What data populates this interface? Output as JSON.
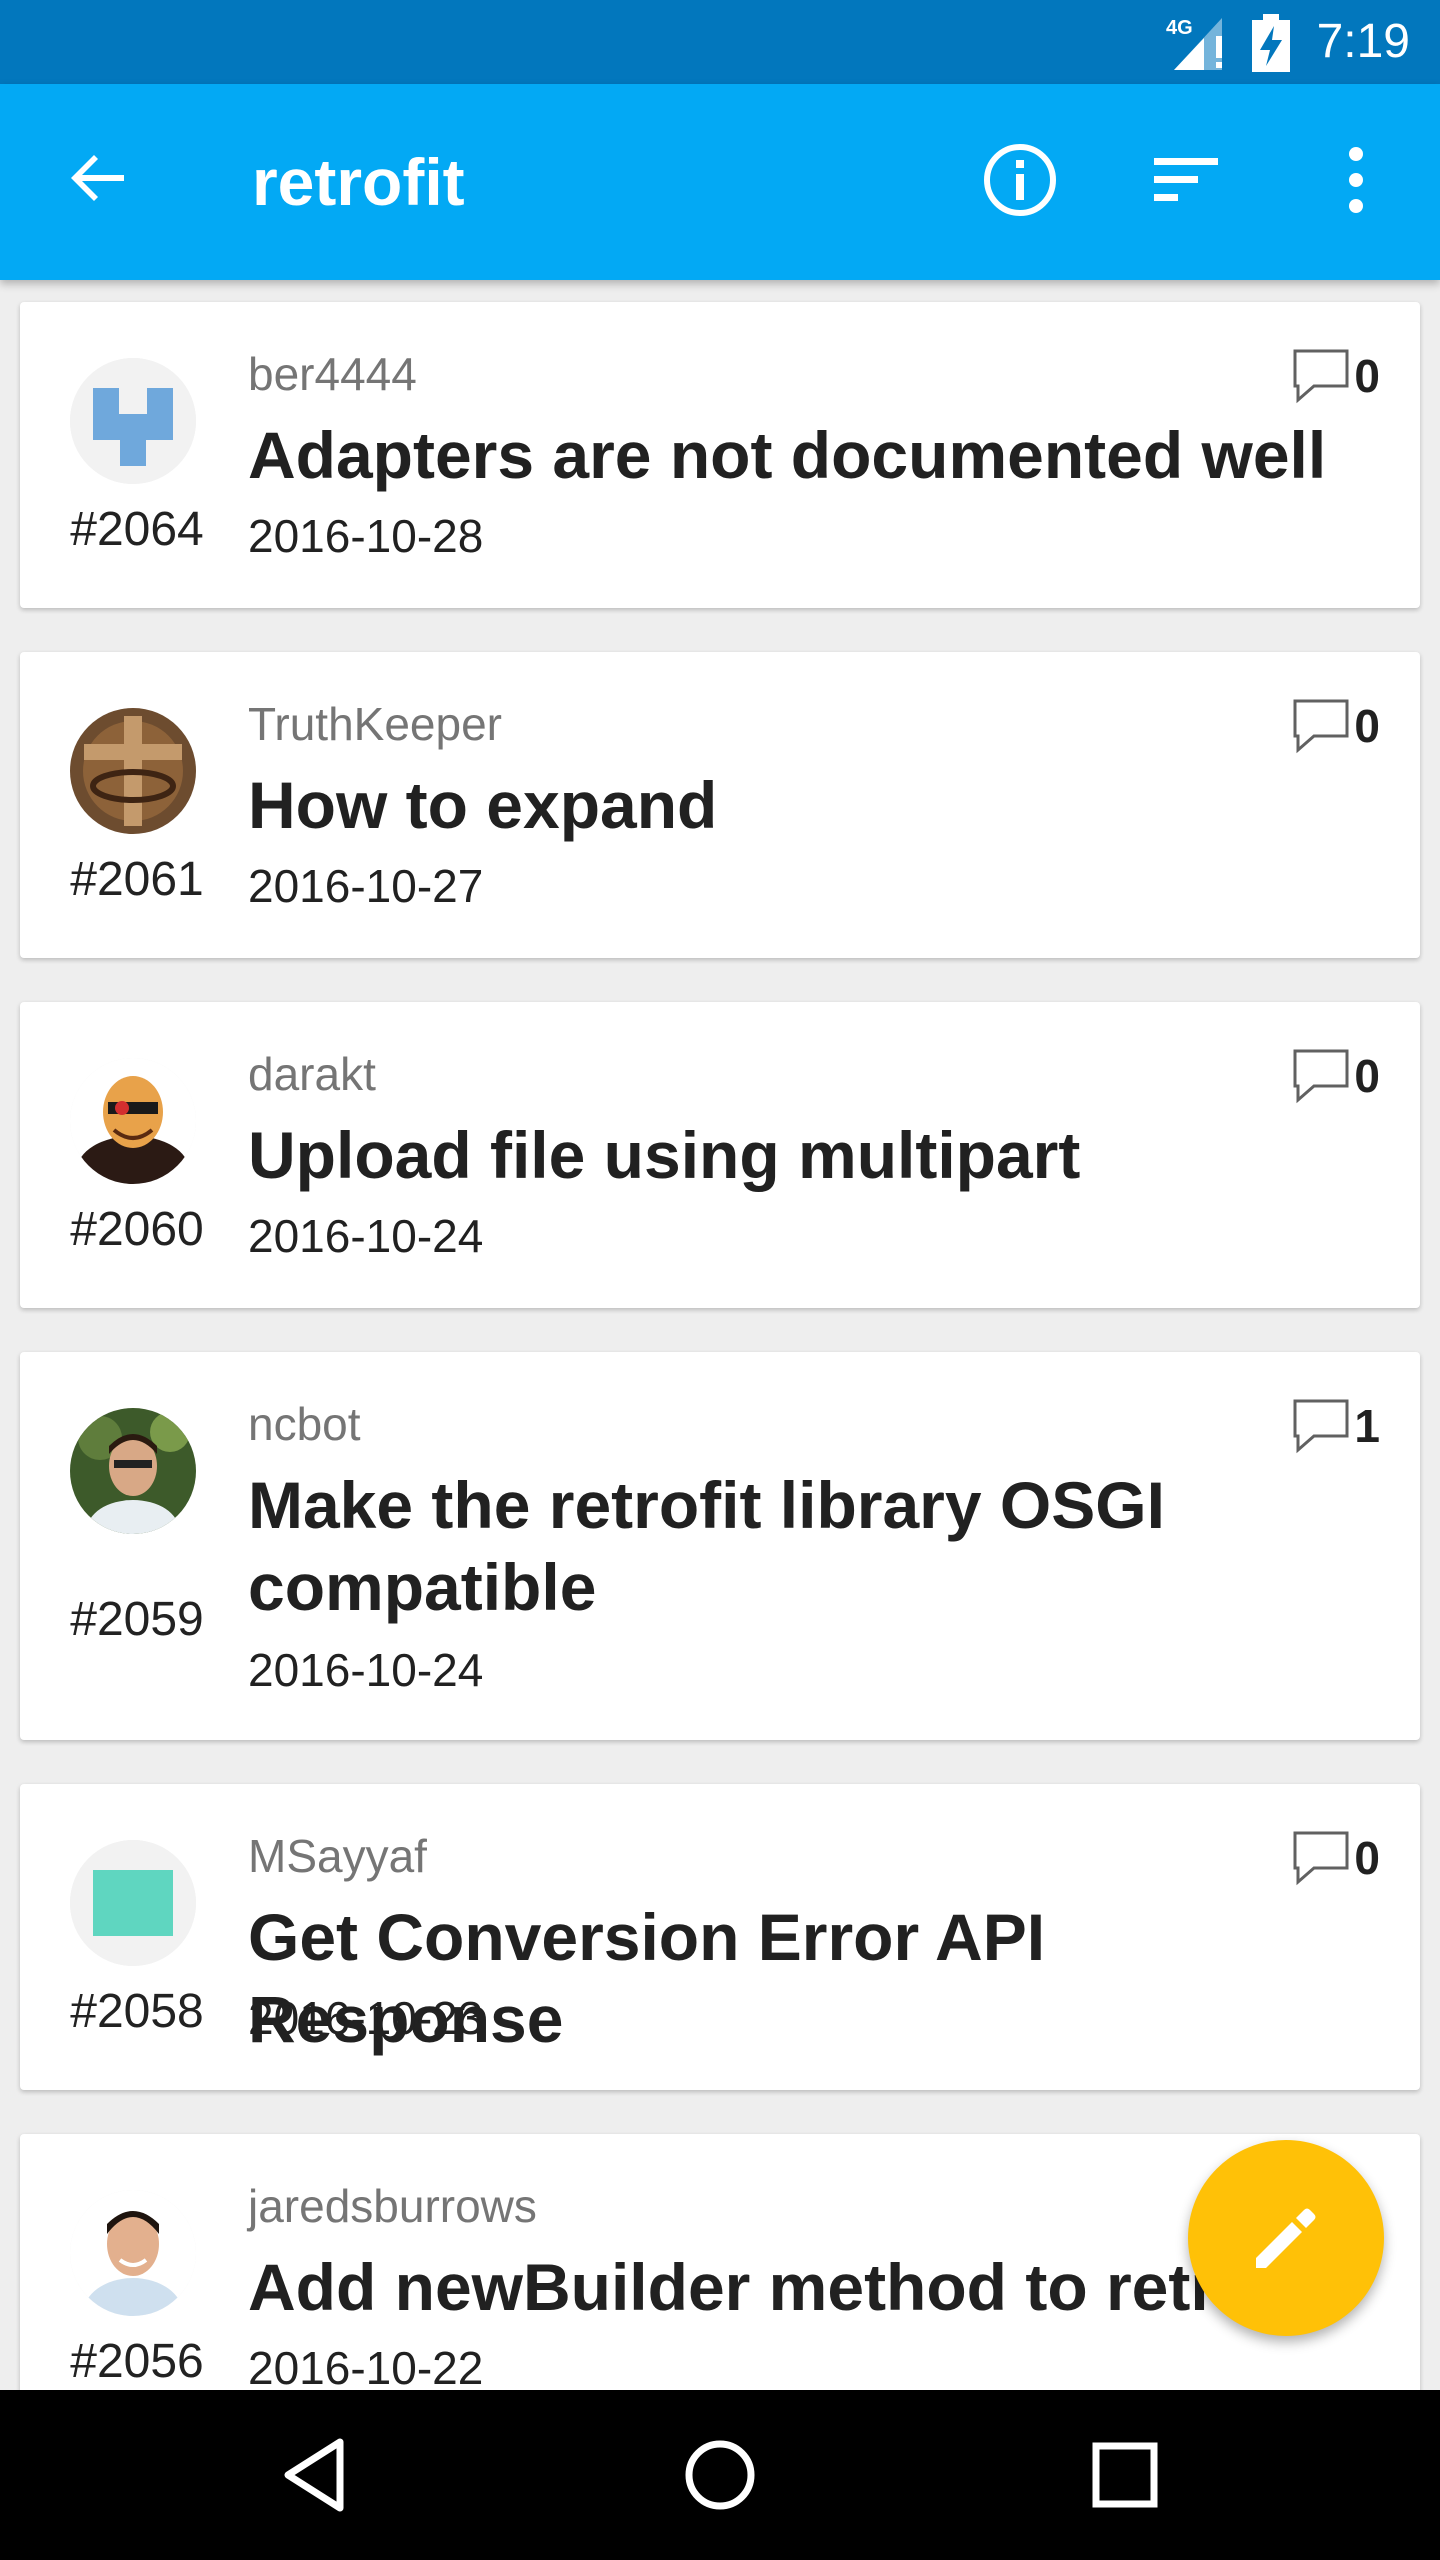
{
  "status_bar": {
    "network": "4G",
    "time": "7:19"
  },
  "toolbar": {
    "title": "retrofit",
    "back_icon": "arrow-back-icon",
    "info_icon": "info-icon",
    "sort_icon": "sort-icon",
    "more_icon": "more-vert-icon"
  },
  "issues": [
    {
      "number": "#2064",
      "user": "ber4444",
      "title": "Adapters are not documented well",
      "date": "2016-10-28",
      "comments": "0"
    },
    {
      "number": "#2061",
      "user": "TruthKeeper",
      "title": "How to expand",
      "date": "2016-10-27",
      "comments": "0"
    },
    {
      "number": "#2060",
      "user": "darakt",
      "title": "Upload file using multipart",
      "date": "2016-10-24",
      "comments": "0"
    },
    {
      "number": "#2059",
      "user": "ncbot",
      "title": "Make the retrofit library OSGI compatible",
      "date": "2016-10-24",
      "comments": "1"
    },
    {
      "number": "#2058",
      "user": "MSayyaf",
      "title": "Get Conversion Error API Response",
      "date": "2016-10-23",
      "comments": "0"
    },
    {
      "number": "#2056",
      "user": "jaredsburrows",
      "title": "Add newBuilder method to retrofit",
      "date": "2016-10-22",
      "comments": ""
    }
  ],
  "fab": {
    "icon": "edit-pencil-icon"
  },
  "colors": {
    "status_bar": "#0277bd",
    "app_bar": "#03a9f4",
    "fab": "#ffc107",
    "background": "#eeeeee"
  },
  "nav_bar": {
    "back_icon": "nav-back-icon",
    "home_icon": "nav-home-icon",
    "recents_icon": "nav-recents-icon"
  }
}
